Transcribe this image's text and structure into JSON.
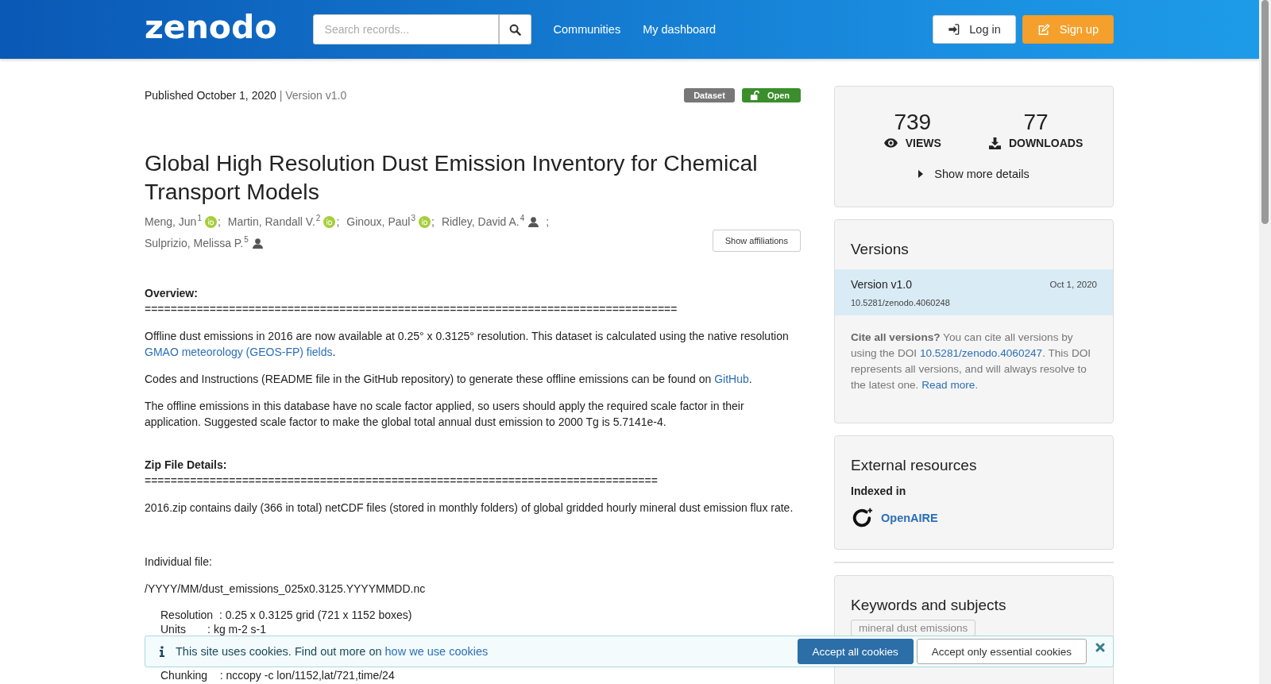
{
  "header": {
    "logo": "zenodo",
    "search": {
      "placeholder": "Search records..."
    },
    "nav": [
      "Communities",
      "My dashboard"
    ],
    "buttons": [
      {
        "label": "Log in",
        "kind": "login"
      },
      {
        "label": "Sign up",
        "kind": "signup"
      }
    ]
  },
  "record": {
    "published": "Published October 1, 2020",
    "version": "| Version v1.0",
    "badges": [
      {
        "label": "Dataset",
        "kind": "type"
      },
      {
        "label": "Open",
        "kind": "access"
      }
    ],
    "title": "Global High Resolution Dust Emission Inventory for Chemical Transport Models",
    "authors": [
      {
        "name": "Meng, Jun",
        "affiliation": "1",
        "kind": "orcid",
        "separator": ";"
      },
      {
        "name": "Martin, Randall V.",
        "affiliation": "2",
        "kind": "orcid",
        "separator": ";"
      },
      {
        "name": "Ginoux, Paul",
        "affiliation": "3",
        "kind": "orcid",
        "separator": ";"
      },
      {
        "name": "Ridley, David A.",
        "affiliation": "4",
        "kind": "person",
        "separator": ";"
      },
      {
        "name": "Sulprizio, Melissa P.",
        "affiliation": "5",
        "kind": "person"
      }
    ],
    "affiliations_button": "Show affiliations",
    "body": [
      {
        "kind": "heading",
        "text": "Overview:"
      },
      {
        "kind": "rule",
        "text": "=================================================================================="
      },
      {
        "kind": "paragraph",
        "parts": [
          {
            "kind": "text",
            "text": "Offline dust emissions in 2016 are now available at 0.25° x 0.3125° resolution. This dataset is calculated using the native resolution "
          },
          {
            "kind": "link",
            "text": "GMAO meteorology (GEOS-FP) fields"
          },
          {
            "kind": "text",
            "text": "."
          }
        ]
      },
      {
        "kind": "paragraph",
        "parts": [
          {
            "kind": "text",
            "text": "Codes and Instructions (README file in the GitHub repository) to generate these offline emissions can be found on "
          },
          {
            "kind": "link",
            "text": "GitHub"
          },
          {
            "kind": "text",
            "text": "."
          }
        ]
      },
      {
        "kind": "paragraph",
        "parts": [
          {
            "kind": "text",
            "text": "The offline emissions in this database have no scale factor applied, so users should apply the required scale factor in their application. Suggested scale factor to make the global total annual dust emission to 2000 Tg is 5.7141e-4."
          }
        ]
      },
      {
        "kind": "heading",
        "text": "Zip File Details:"
      },
      {
        "kind": "rule",
        "text": "==============================================================================="
      },
      {
        "kind": "paragraph",
        "parts": [
          {
            "kind": "text",
            "text": "2016.zip contains daily (366 in total) netCDF files (stored in monthly folders) of global gridded hourly mineral dust emission flux rate."
          }
        ]
      },
      {
        "kind": "label",
        "text": "Individual file:"
      },
      {
        "kind": "paragraph",
        "parts": [
          {
            "kind": "text",
            "text": "/YYYY/MM/dust_emissions_025x0.3125.YYYYMMDD.nc"
          }
        ]
      },
      {
        "kind": "spec",
        "text": "Resolution  : 0.25 x 0.3125 grid (721 x 1152 boxes)"
      },
      {
        "kind": "spec",
        "text": "Units       : kg m-2 s-1"
      },
      {
        "kind": "spec",
        "text": "Chunking    : nccopy -c lon/1152,lat/721,time/24"
      }
    ]
  },
  "sidebar": {
    "stats": [
      {
        "value": "739",
        "label": "VIEWS"
      },
      {
        "value": "77",
        "label": "DOWNLOADS"
      }
    ],
    "more_details": {
      "label": "Show more details",
      "expanded": false
    },
    "versions": {
      "title": "Versions",
      "items": [
        {
          "label": "Version v1.0",
          "date": "Oct 1, 2020",
          "doi": "10.5281/zenodo.4060248",
          "selected": true
        }
      ],
      "cite": [
        {
          "kind": "bold",
          "text": "Cite all versions?"
        },
        {
          "kind": "text",
          "text": " You can cite all versions by using the DOI "
        },
        {
          "kind": "link",
          "text": "10.5281/zenodo.4060247"
        },
        {
          "kind": "text",
          "text": ". This DOI represents all versions, and will always resolve to the latest one. "
        },
        {
          "kind": "link",
          "text": "Read more"
        },
        {
          "kind": "text",
          "text": "."
        }
      ]
    },
    "external": {
      "title": "External resources",
      "subtitle": "Indexed in",
      "link": "OpenAIRE"
    },
    "keywords": {
      "title": "Keywords and subjects",
      "tags": [
        "mineral dust emissions"
      ]
    }
  },
  "cookie_bar": {
    "parts": [
      {
        "kind": "text",
        "text": "This site uses cookies. Find out more on "
      },
      {
        "kind": "link",
        "text": "how we use cookies"
      }
    ],
    "buttons": [
      {
        "label": "Accept all cookies",
        "kind": "primary"
      },
      {
        "label": "Accept only essential cookies",
        "kind": "default"
      }
    ]
  }
}
